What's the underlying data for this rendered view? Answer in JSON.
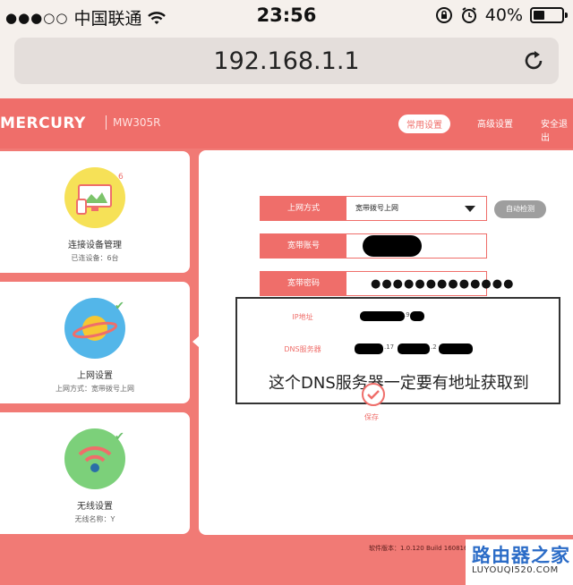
{
  "status_bar": {
    "signal_dots": "●●●○○",
    "carrier": "中国联通",
    "time": "23:56",
    "battery_percent": "40%",
    "battery_level": 0.4
  },
  "browser": {
    "url": "192.168.1.1"
  },
  "header": {
    "logo": "MERCURY",
    "model": "MW305R",
    "nav": [
      "常用设置",
      "高级设置",
      "安全退出"
    ]
  },
  "sidebar": {
    "cards": [
      {
        "title": "连接设备管理",
        "subtitle": "已连设备：6台",
        "badge": "6",
        "icon": "devices-icon"
      },
      {
        "title": "上网设置",
        "subtitle": "上网方式：宽带拨号上网",
        "icon": "planet-icon"
      },
      {
        "title": "无线设置",
        "subtitle": "无线名称：Y",
        "icon": "wifi-icon"
      }
    ]
  },
  "form": {
    "connection_type_label": "上网方式",
    "connection_type_value": "宽带拨号上网",
    "auto_detect": "自动检测",
    "account_label": "宽带账号",
    "password_label": "宽带密码",
    "password_value": "●●●●●●●●●●●●●",
    "ip_label": "IP地址",
    "ip_partial": ".9",
    "dns_label": "DNS服务器",
    "dns_partial_1": ".17",
    "dns_partial_2": ".2",
    "save": "保存"
  },
  "annotation": "这个DNS服务器一定要有地址获取到",
  "footer": {
    "version": "软件版本：1.0.120 Build 160816 Rel.64085n 硬件版本：MW305R 2.0.00000000"
  },
  "watermark": {
    "title": "路由器之家",
    "url": "LUYOUQI520.COM"
  },
  "colors": {
    "accent": "#ef6e6a",
    "background": "#f17a75"
  }
}
